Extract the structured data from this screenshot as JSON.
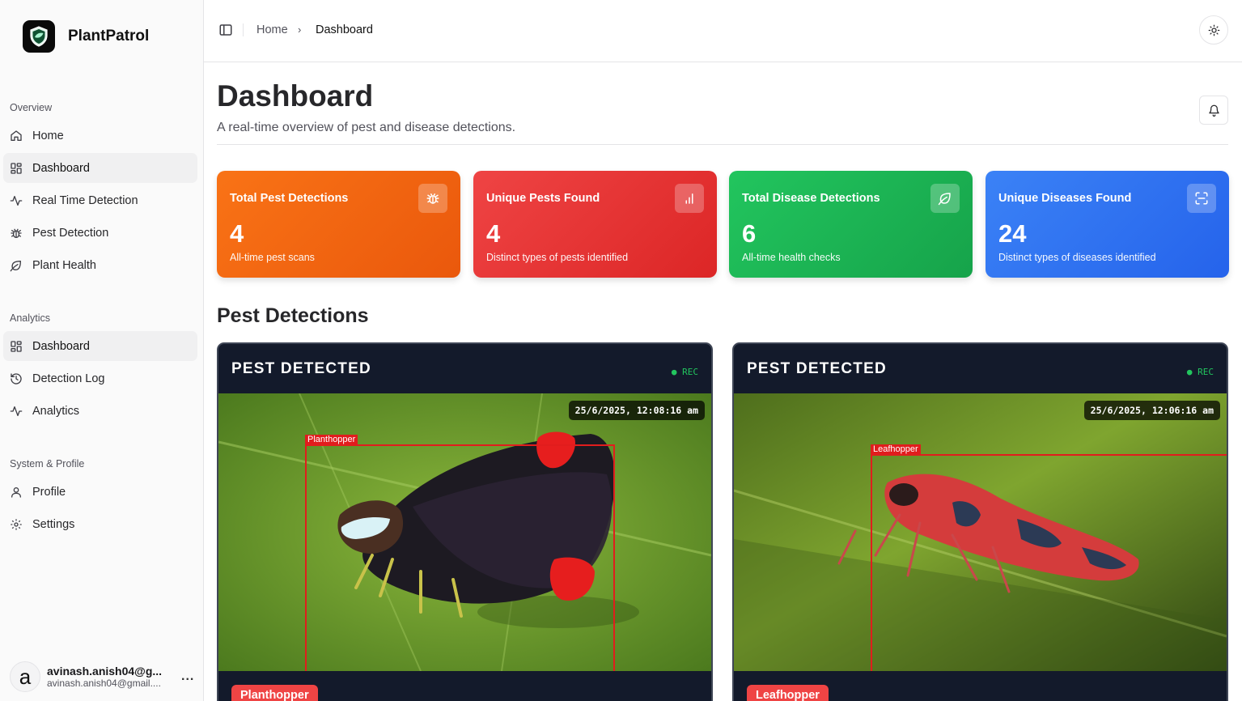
{
  "app": {
    "name": "PlantPatrol"
  },
  "sidebar": {
    "sections": [
      {
        "label": "Overview",
        "items": [
          {
            "label": "Home",
            "icon": "home-icon"
          },
          {
            "label": "Dashboard",
            "icon": "layout-grid-icon",
            "active": true
          },
          {
            "label": "Real Time Detection",
            "icon": "activity-icon"
          },
          {
            "label": "Pest Detection",
            "icon": "bug-icon"
          },
          {
            "label": "Plant Health",
            "icon": "leaf-icon"
          }
        ]
      },
      {
        "label": "Analytics",
        "items": [
          {
            "label": "Dashboard",
            "icon": "layout-grid-icon",
            "active": true
          },
          {
            "label": "Detection Log",
            "icon": "history-icon"
          },
          {
            "label": "Analytics",
            "icon": "activity-icon"
          }
        ]
      },
      {
        "label": "System & Profile",
        "items": [
          {
            "label": "Profile",
            "icon": "user-icon"
          },
          {
            "label": "Settings",
            "icon": "gear-icon"
          }
        ]
      }
    ],
    "user": {
      "avatar_letter": "a",
      "name": "avinash.anish04@g...",
      "email": "avinash.anish04@gmail....",
      "more": "..."
    }
  },
  "topbar": {
    "breadcrumb": {
      "home": "Home",
      "separator": "›",
      "current": "Dashboard"
    }
  },
  "page": {
    "title": "Dashboard",
    "subtitle": "A real-time overview of pest and disease detections."
  },
  "stats": [
    {
      "title": "Total Pest Detections",
      "value": "4",
      "desc": "All-time pest scans",
      "icon": "bug-icon",
      "color": "#f97316"
    },
    {
      "title": "Unique Pests Found",
      "value": "4",
      "desc": "Distinct types of pests identified",
      "icon": "bar-chart-icon",
      "color": "#ef4444"
    },
    {
      "title": "Total Disease Detections",
      "value": "6",
      "desc": "All-time health checks",
      "icon": "leaf-icon",
      "color": "#22c55e"
    },
    {
      "title": "Unique Diseases Found",
      "value": "24",
      "desc": "Distinct types of diseases identified",
      "icon": "scan-icon",
      "color": "#3b82f6"
    }
  ],
  "pest_section": {
    "title": "Pest Detections",
    "cards": [
      {
        "header": "PEST DETECTED",
        "rec": "● REC",
        "timestamp": "25/6/2025, 12:08:16 am",
        "label": "Planthopper",
        "tag": "Planthopper"
      },
      {
        "header": "PEST DETECTED",
        "rec": "● REC",
        "timestamp": "25/6/2025, 12:06:16 am",
        "label": "Leafhopper",
        "tag": "Leafhopper"
      }
    ]
  }
}
